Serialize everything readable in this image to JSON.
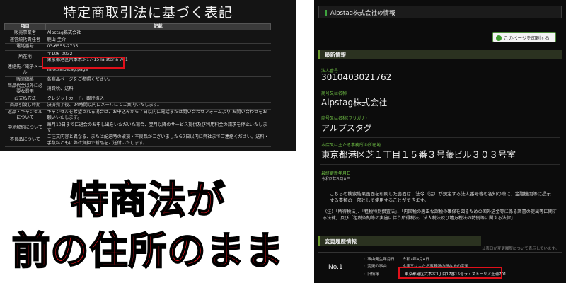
{
  "left": {
    "title": "特定商取引法に基づく表記",
    "headers": [
      "項目",
      "記載"
    ],
    "rows": [
      {
        "k": "販売事業者",
        "v": "Alpstag株式会社"
      },
      {
        "k": "運営統括責任者",
        "v": "鹿山 圭介"
      },
      {
        "k": "電話番号",
        "v": "03-6555-2735"
      },
      {
        "k": "所在地",
        "v": "〒106-0032\n東京都港区六本木3-17-15 la storia 701"
      },
      {
        "k": "連絡先／電子メール",
        "v": "info@alpstag.page"
      },
      {
        "k": "販売価格",
        "v": "各商品ページをご参照ください。"
      },
      {
        "k": "商品代金以外に必要な費用",
        "v": "消費税、送料"
      },
      {
        "k": "お支払方法",
        "v": "クレジットカード、銀行振込"
      },
      {
        "k": "商品引渡し時期",
        "v": "決済完了後、24時間以内にメールにてご案内いたします。"
      },
      {
        "k": "返品・キャンセルについて",
        "v": "キャンセルを希望される場合は、お申込みから７日以内に電話または問い合わせフォームより お問い合わせをお願いいたします。"
      },
      {
        "k": "中途解約について",
        "v": "毎月10日までに退会のお申し出をいただいた場合、翌月以降のサービス提供及び利用料金の請求を停止いたします"
      },
      {
        "k": "不良品について",
        "v": "ご注文内容と異なる、または配送時の破損・不良品がございましたら7日以内に弊社までご連絡ください。送料・手数料ともに弊社負担で新品をご送付いたします。"
      }
    ]
  },
  "caption": {
    "line1": "特商法が",
    "line2": "前の住所のまま"
  },
  "right": {
    "header": "Alpstag株式会社の情報",
    "print_button": "このページを印刷する",
    "section_latest": "最新情報",
    "corp_number_label": "法人番号",
    "corp_number": "3010403021762",
    "name_label": "商号又は名称",
    "name": "Alpstag株式会社",
    "kana_label": "商号又は名称(フリガナ)",
    "kana": "アルプスタグ",
    "address_label": "本店又は主たる事務所の所在地",
    "address": "東京都港区芝１丁目１５番３号藤ビル３０３号室",
    "updated_label": "最終更新年月日",
    "updated": "令和7年5月8日",
    "note1": "こちらの検索結果画面を印刷した書面は、法令（注）が規定する法人番号等の各知の際に、金融機関等に提示する書類の一部として使用することができます。",
    "note2": "（注）「所得税法」、「租税特別措置法」、「内国税の適正な課税の確保を図るための国外送金等に係る調書の提出等に関する法律」及び「租税条約等の実施に伴う所得税法、法人税法及び地方税法の特例等に関する法律」",
    "section_history": "変更履歴情報",
    "history_note": "公表日が変更履歴について表示しています。",
    "history_no": "No.1",
    "history_date": "・ 事由発生年月日　　令和7年4月4日",
    "history_reason": "・ 変更の事由　　　　本店又は主たる事務所の所在地の変更",
    "history_old": "・ 旧情報",
    "history_old_addr": "東京都港区六本木3丁目17番15号ラ・ストーリア芝浦701"
  }
}
